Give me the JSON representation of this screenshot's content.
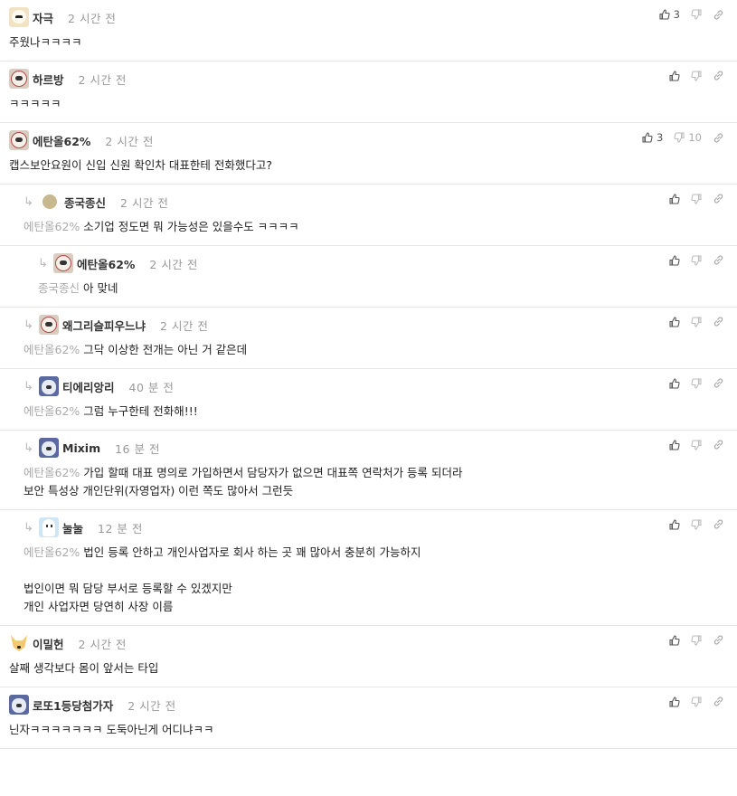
{
  "comments": [
    {
      "nick": "자극",
      "time": "2 시간 전",
      "avatar": "dog",
      "level": 0,
      "mention": "",
      "lines": [
        "주웠나ㅋㅋㅋㅋ"
      ],
      "up": "3",
      "down": ""
    },
    {
      "nick": "하르방",
      "time": "2 시간 전",
      "avatar": "pug",
      "level": 0,
      "mention": "",
      "lines": [
        "ㅋㅋㅋㅋㅋ"
      ],
      "up": "",
      "down": ""
    },
    {
      "nick": "에탄올62%",
      "time": "2 시간 전",
      "avatar": "pug",
      "level": 0,
      "mention": "",
      "lines": [
        "캡스보안요원이 신입 신원 확인차 대표한테 전화했다고?"
      ],
      "up": "3",
      "down": "10"
    },
    {
      "nick": "종국종신",
      "time": "2 시간 전",
      "avatar": "circle",
      "level": 1,
      "mention": "에탄올62%",
      "lines": [
        "소기업 정도면 뭐 가능성은 있을수도 ㅋㅋㅋㅋ"
      ],
      "up": "",
      "down": ""
    },
    {
      "nick": "에탄올62%",
      "time": "2 시간 전",
      "avatar": "pug",
      "level": 2,
      "mention": "종국종신",
      "lines": [
        "아 맞네"
      ],
      "up": "",
      "down": ""
    },
    {
      "nick": "왜그리슬피우느냐",
      "time": "2 시간 전",
      "avatar": "pug",
      "level": 1,
      "mention": "에탄올62%",
      "lines": [
        "그닥 이상한 전개는 아닌 거 같은데"
      ],
      "up": "",
      "down": ""
    },
    {
      "nick": "티에리앙리",
      "time": "40 분 전",
      "avatar": "husky",
      "level": 1,
      "mention": "에탄올62%",
      "lines": [
        "그럼 누구한테 전화해!!!"
      ],
      "up": "",
      "down": ""
    },
    {
      "nick": "Mixim",
      "time": "16 분 전",
      "avatar": "husky",
      "level": 1,
      "mention": "에탄올62%",
      "lines": [
        "가입 할때 대표 명의로 가입하면서 담당자가 없으면 대표쪽 연락처가 등록 되더라",
        "보안 특성상 개인단위(자영업자) 이런 쪽도 많아서 그런듯"
      ],
      "up": "",
      "down": ""
    },
    {
      "nick": "눌눌",
      "time": "12 분 전",
      "avatar": "ghost",
      "level": 1,
      "mention": "에탄올62%",
      "lines": [
        "법인 등록 안하고 개인사업자로 회사 하는 곳 꽤 많아서 충분히 가능하지",
        "",
        "법인이면 뭐 담당 부서로 등록할 수 있겠지만",
        "개인 사업자면 당연히 사장 이름"
      ],
      "up": "",
      "down": ""
    },
    {
      "nick": "이밀헌",
      "time": "2 시간 전",
      "avatar": "fox",
      "level": 0,
      "mention": "",
      "lines": [
        "살째 생각보다 몸이 앞서는 타입"
      ],
      "up": "",
      "down": ""
    },
    {
      "nick": "로또1등당첨가자",
      "time": "2 시간 전",
      "avatar": "husky",
      "level": 0,
      "mention": "",
      "lines": [
        "닌자ㅋㅋㅋㅋㅋㅋㅋ 도둑아닌게 어디냐ㅋㅋ"
      ],
      "up": "",
      "down": ""
    }
  ],
  "icons": {
    "upvote": "thumbs-up-icon",
    "downvote": "thumbs-down-icon",
    "link": "link-icon",
    "reply_arrow": "reply-arrow-icon"
  },
  "colors": {
    "divider": "#e6e6e6",
    "muted": "#999999",
    "mention": "#aaaaaa"
  }
}
